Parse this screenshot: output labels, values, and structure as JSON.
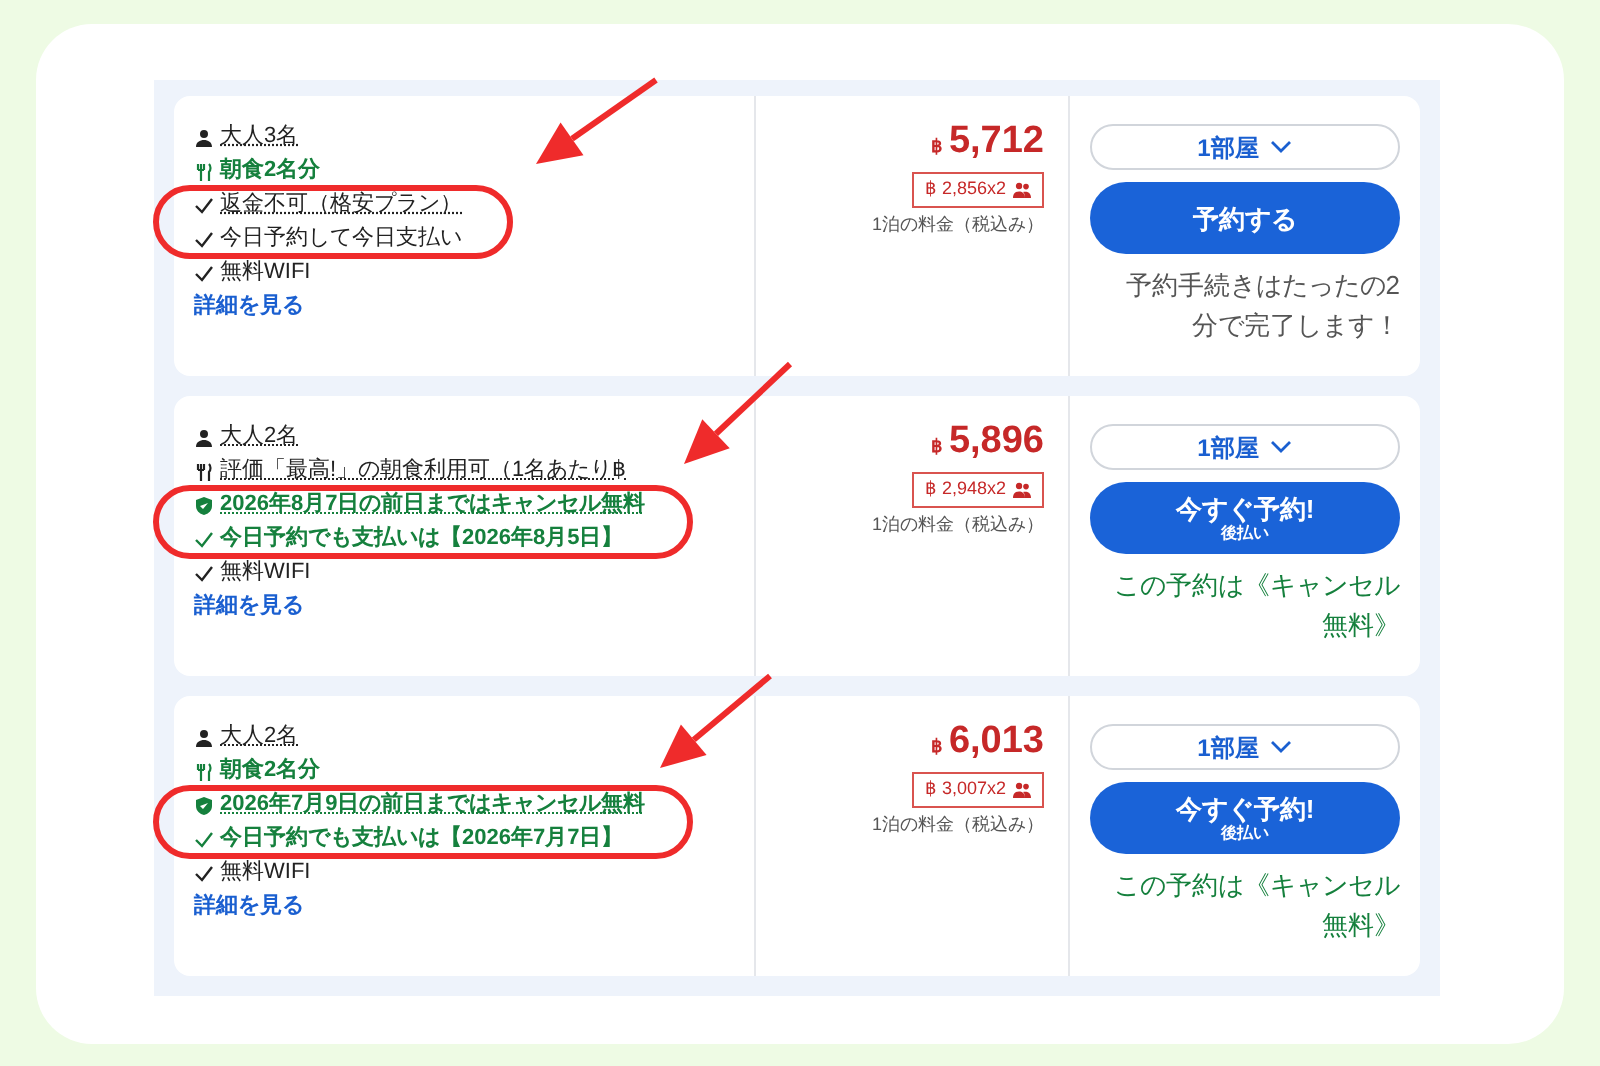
{
  "rooms": [
    {
      "features": [
        {
          "kind": "guests",
          "text": "大人3名"
        },
        {
          "kind": "meal",
          "text": "朝食2名分"
        },
        {
          "kind": "policy",
          "text": "返金不可（格安プラン）"
        },
        {
          "kind": "plain",
          "text": "今日予約して今日支払い"
        },
        {
          "kind": "plain",
          "text": "無料WIFI"
        }
      ],
      "details": "詳細を見る",
      "currency": "฿",
      "price": "5,712",
      "per_person": "฿ 2,856x2",
      "price_note": "1泊の料金（税込み）",
      "rooms_select": "1部屋",
      "button": {
        "label": "予約する"
      },
      "note": {
        "kind": "info",
        "text": "予約手続きはたったの2分で完了します！"
      }
    },
    {
      "features": [
        {
          "kind": "guests",
          "text": "大人2名"
        },
        {
          "kind": "meal_rated",
          "text": "評価「最高!」の朝食利用可（1名あたり฿"
        },
        {
          "kind": "cancel",
          "text": "2026年8月7日の前日まではキャンセル無料"
        },
        {
          "kind": "pay",
          "text": "今日予約でも支払いは【2026年8月5日】"
        },
        {
          "kind": "plain",
          "text": "無料WIFI"
        }
      ],
      "details": "詳細を見る",
      "currency": "฿",
      "price": "5,896",
      "per_person": "฿ 2,948x2",
      "price_note": "1泊の料金（税込み）",
      "rooms_select": "1部屋",
      "button": {
        "label": "今すぐ予約!",
        "sublabel": "後払い"
      },
      "note": {
        "kind": "free_cancel",
        "text": "この予約は《キャンセル無料》"
      }
    },
    {
      "features": [
        {
          "kind": "guests",
          "text": "大人2名"
        },
        {
          "kind": "meal",
          "text": "朝食2名分"
        },
        {
          "kind": "cancel",
          "text": "2026年7月9日の前日まではキャンセル無料"
        },
        {
          "kind": "pay",
          "text": "今日予約でも支払いは【2026年7月7日】"
        },
        {
          "kind": "plain",
          "text": "無料WIFI"
        }
      ],
      "details": "詳細を見る",
      "currency": "฿",
      "price": "6,013",
      "per_person": "฿ 3,007x2",
      "price_note": "1泊の料金（税込み）",
      "rooms_select": "1部屋",
      "button": {
        "label": "今すぐ予約!",
        "sublabel": "後払い"
      },
      "note": {
        "kind": "free_cancel",
        "text": "この予約は《キャンセル無料》"
      }
    }
  ]
}
